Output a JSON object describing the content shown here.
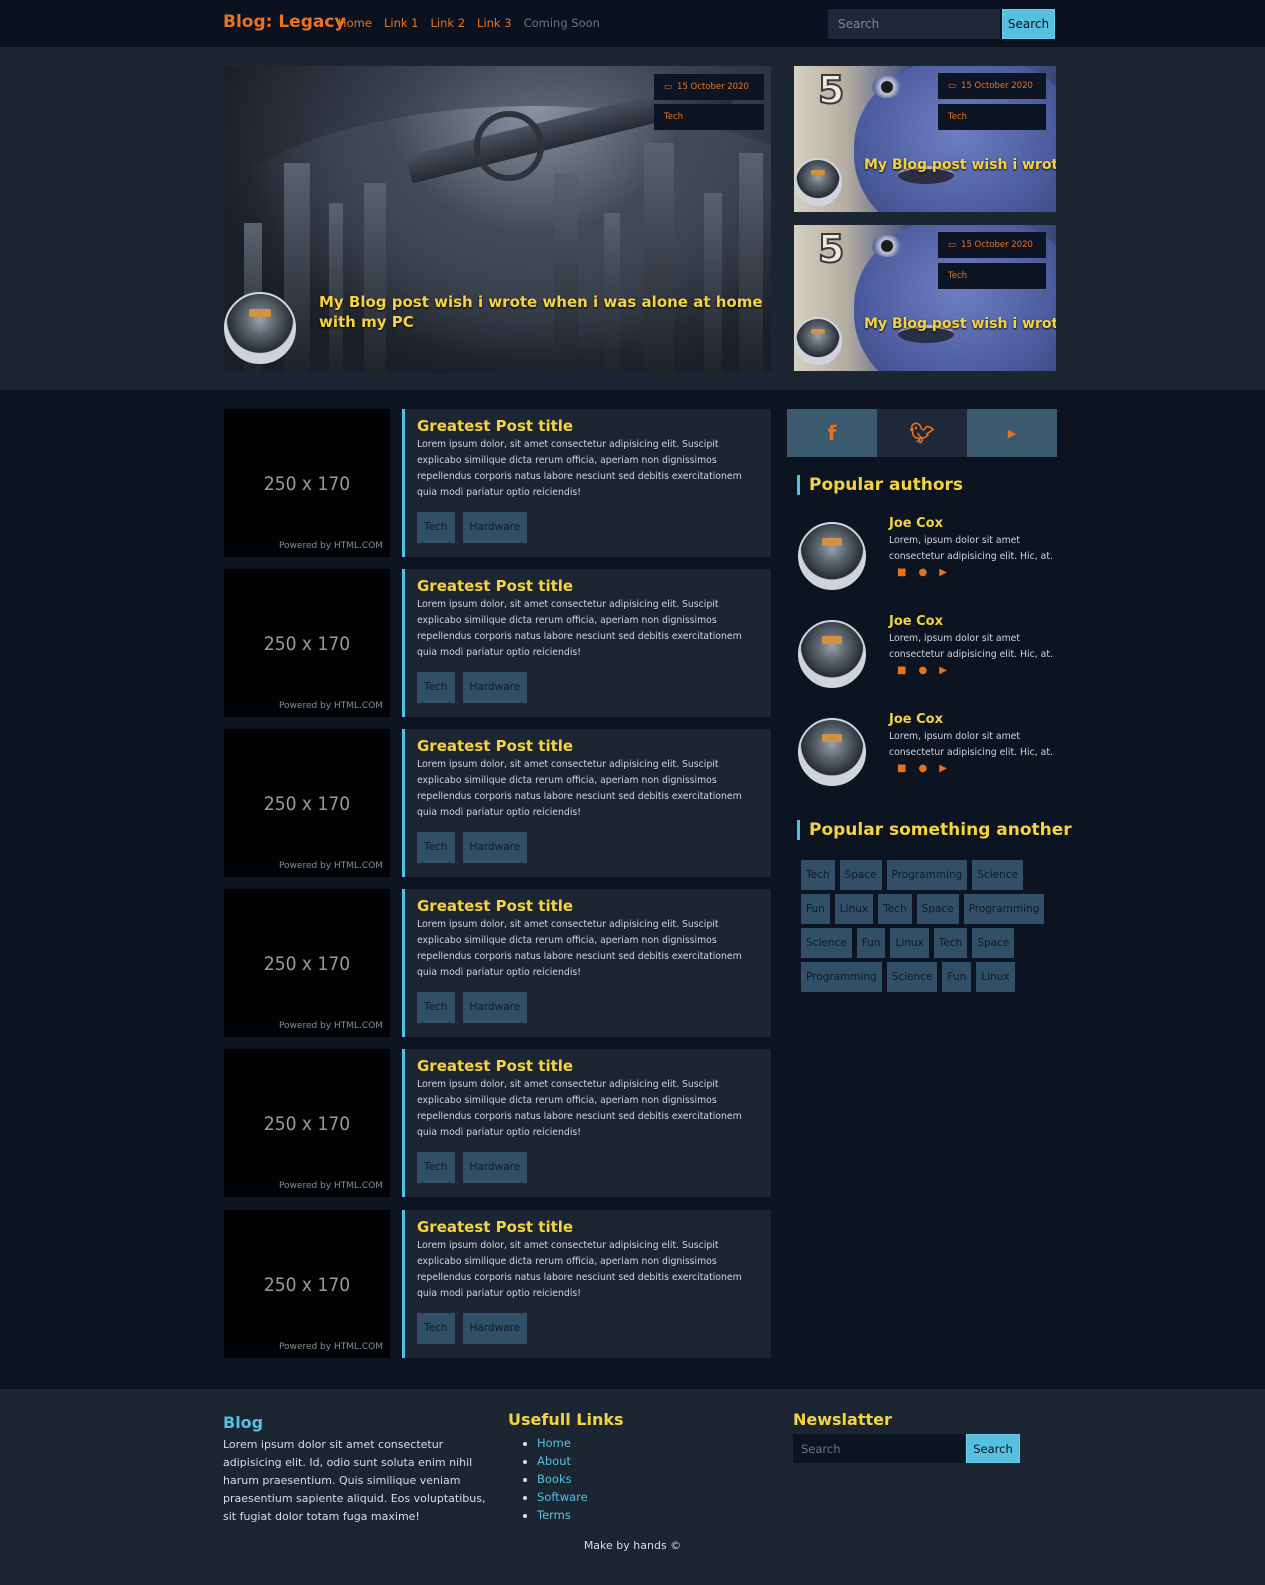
{
  "nav": {
    "brand": "Blog: Legacy",
    "links": [
      "Home",
      "Link 1",
      "Link 2",
      "Link 3"
    ],
    "disabled_link": "Coming Soon",
    "search_placeholder": "Search",
    "search_button": "Search"
  },
  "hero": {
    "main": {
      "date": "15 October 2020",
      "category": "Tech",
      "title": "My Blog post wish i wrote when i was alone at home with my PC"
    },
    "side": [
      {
        "date": "15 October 2020",
        "category": "Tech",
        "title": "My Blog post wish i wrote",
        "badge": "5"
      },
      {
        "date": "15 October 2020",
        "category": "Tech",
        "title": "My Blog post wish i wrote",
        "badge": "5"
      }
    ]
  },
  "posts": [
    {
      "thumb_label": "250 x 170",
      "thumb_credit": "Powered by HTML.COM",
      "title": "Greatest Post title",
      "text": "Lorem ipsum dolor, sit amet consectetur adipisicing elit. Suscipit explicabo similique dicta rerum officia, aperiam non dignissimos repellendus corporis natus labore nesciunt sed debitis exercitationem quia modi pariatur optio reiciendis!",
      "tags": [
        "Tech",
        "Hardware"
      ]
    },
    {
      "thumb_label": "250 x 170",
      "thumb_credit": "Powered by HTML.COM",
      "title": "Greatest Post title",
      "text": "Lorem ipsum dolor, sit amet consectetur adipisicing elit. Suscipit explicabo similique dicta rerum officia, aperiam non dignissimos repellendus corporis natus labore nesciunt sed debitis exercitationem quia modi pariatur optio reiciendis!",
      "tags": [
        "Tech",
        "Hardware"
      ]
    },
    {
      "thumb_label": "250 x 170",
      "thumb_credit": "Powered by HTML.COM",
      "title": "Greatest Post title",
      "text": "Lorem ipsum dolor, sit amet consectetur adipisicing elit. Suscipit explicabo similique dicta rerum officia, aperiam non dignissimos repellendus corporis natus labore nesciunt sed debitis exercitationem quia modi pariatur optio reiciendis!",
      "tags": [
        "Tech",
        "Hardware"
      ]
    },
    {
      "thumb_label": "250 x 170",
      "thumb_credit": "Powered by HTML.COM",
      "title": "Greatest Post title",
      "text": "Lorem ipsum dolor, sit amet consectetur adipisicing elit. Suscipit explicabo similique dicta rerum officia, aperiam non dignissimos repellendus corporis natus labore nesciunt sed debitis exercitationem quia modi pariatur optio reiciendis!",
      "tags": [
        "Tech",
        "Hardware"
      ]
    },
    {
      "thumb_label": "250 x 170",
      "thumb_credit": "Powered by HTML.COM",
      "title": "Greatest Post title",
      "text": "Lorem ipsum dolor, sit amet consectetur adipisicing elit. Suscipit explicabo similique dicta rerum officia, aperiam non dignissimos repellendus corporis natus labore nesciunt sed debitis exercitationem quia modi pariatur optio reiciendis!",
      "tags": [
        "Tech",
        "Hardware"
      ]
    },
    {
      "thumb_label": "250 x 170",
      "thumb_credit": "Powered by HTML.COM",
      "title": "Greatest Post title",
      "text": "Lorem ipsum dolor, sit amet consectetur adipisicing elit. Suscipit explicabo similique dicta rerum officia, aperiam non dignissimos repellendus corporis natus labore nesciunt sed debitis exercitationem quia modi pariatur optio reiciendis!",
      "tags": [
        "Tech",
        "Hardware"
      ]
    }
  ],
  "sidebar": {
    "social_icons": [
      "facebook-icon",
      "twitter-icon",
      "youtube-icon"
    ],
    "social_colors": [
      "#3b5a70",
      "#1e2838",
      "#3b5a70"
    ],
    "authors_title": "Popular authors",
    "authors": [
      {
        "name": "Joe Cox",
        "desc": "Lorem, ipsum dolor sit amet consectetur adipisicing elit. Hic, at.",
        "icons": [
          "facebook-icon",
          "telegram-icon",
          "youtube-icon"
        ]
      },
      {
        "name": "Joe Cox",
        "desc": "Lorem, ipsum dolor sit amet consectetur adipisicing elit. Hic, at.",
        "icons": [
          "facebook-icon",
          "telegram-icon",
          "youtube-icon"
        ]
      },
      {
        "name": "Joe Cox",
        "desc": "Lorem, ipsum dolor sit amet consectetur adipisicing elit. Hic, at.",
        "icons": [
          "facebook-icon",
          "telegram-icon",
          "youtube-icon"
        ]
      }
    ],
    "tags_title": "Popular something another",
    "tag_cloud": [
      "Tech",
      "Space",
      "Programming",
      "Science",
      "Fun",
      "Linux",
      "Tech",
      "Space",
      "Programming",
      "Science",
      "Fun",
      "Linux",
      "Tech",
      "Space",
      "Programming",
      "Science",
      "Fun",
      "Linux"
    ]
  },
  "footer": {
    "blog_title": "Blog",
    "blog_text": "Lorem ipsum dolor sit amet consectetur adipisicing elit. Id, odio sunt soluta enim nihil harum praesentium. Quis similique veniam praesentium sapiente aliquid. Eos voluptatibus, sit fugiat dolor totam fuga maxime!",
    "links_title": "Usefull Links",
    "links": [
      "Home",
      "About",
      "Books",
      "Software",
      "Terms"
    ],
    "newsletter_title": "Newslatter",
    "newsletter_placeholder": "Search",
    "newsletter_button": "Search",
    "copyright": "Make by hands ©"
  },
  "colors": {
    "accent": "#e8731f",
    "title_yellow": "#f5d340",
    "cyan": "#57bfe0",
    "tag_bg": "#314f67"
  }
}
